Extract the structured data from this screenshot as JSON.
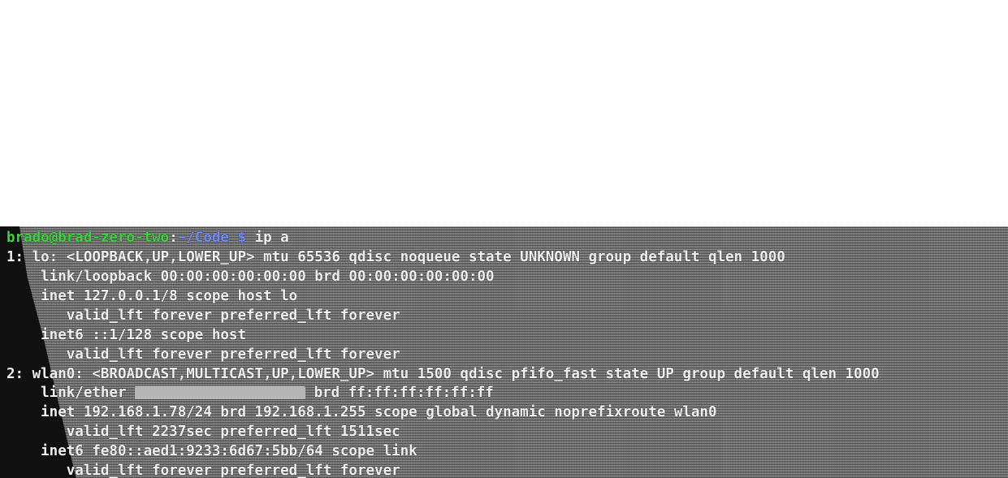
{
  "prompt": {
    "user_host": "brado@brad-zero-two",
    "separator": ":",
    "cwd": "~/Code",
    "dollar": " $",
    "command": " ip a"
  },
  "lines": {
    "l1": "1: lo: <LOOPBACK,UP,LOWER_UP> mtu 65536 qdisc noqueue state UNKNOWN group default qlen 1000",
    "l2": "    link/loopback 00:00:00:00:00:00 brd 00:00:00:00:00:00",
    "l3": "    inet 127.0.0.1/8 scope host lo",
    "l4": "       valid_lft forever preferred_lft forever",
    "l5": "    inet6 ::1/128 scope host",
    "l6": "       valid_lft forever preferred_lft forever",
    "l7": "2: wlan0: <BROADCAST,MULTICAST,UP,LOWER_UP> mtu 1500 qdisc pfifo_fast state UP group default qlen 1000",
    "l8_prefix": "    link/ether ",
    "l8_suffix": " brd ff:ff:ff:ff:ff:ff",
    "l9": "    inet 192.168.1.78/24 brd 192.168.1.255 scope global dynamic noprefixroute wlan0",
    "l10": "       valid_lft 2237sec preferred_lft 1511sec",
    "l11": "    inet6 fe80::aed1:9233:6d67:5bb/64 scope link",
    "l12": "       valid_lft forever preferred_lft forever"
  }
}
